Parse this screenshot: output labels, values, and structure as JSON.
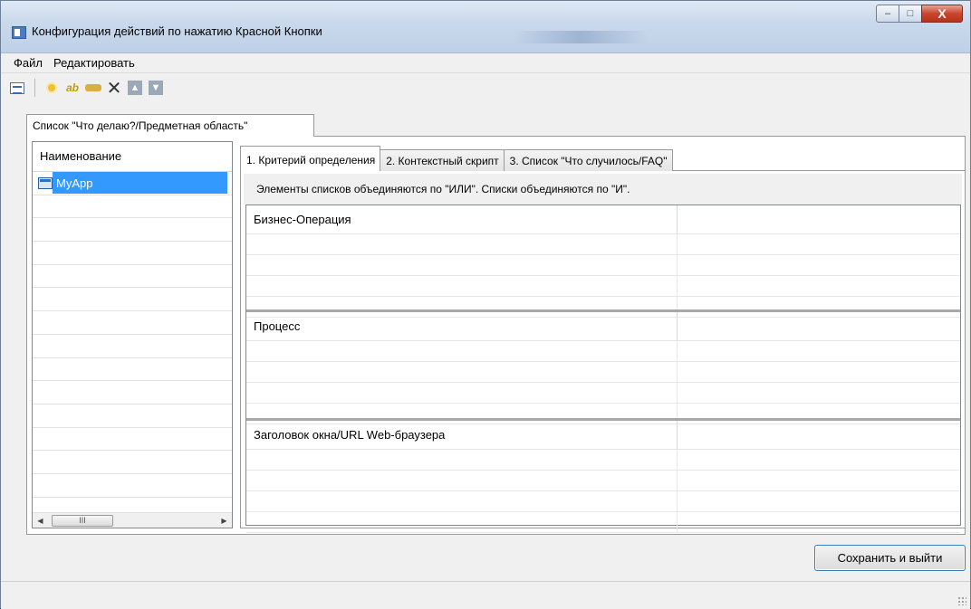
{
  "window": {
    "title": "Конфигурация действий по нажатию Красной Кнопки",
    "buttons": {
      "minimize": "–",
      "maximize": "□",
      "close": "X"
    }
  },
  "menubar": {
    "items": [
      "Файл",
      "Редактировать"
    ]
  },
  "toolbar": {
    "icons": [
      "properties-icon",
      "new-item-icon",
      "rename-icon",
      "key-icon",
      "delete-icon",
      "move-up-icon",
      "move-down-icon"
    ]
  },
  "outer_tab": {
    "label": "Список \"Что делаю?/Предметная область\""
  },
  "left_list": {
    "header": "Наименование",
    "items": [
      "MyApp"
    ],
    "scroll_thumb": "III"
  },
  "inner_tabs": [
    {
      "label": "1. Критерий определения",
      "active": true
    },
    {
      "label": "2. Контекстный скрипт",
      "active": false
    },
    {
      "label": "3. Список \"Что случилось/FAQ\"",
      "active": false
    }
  ],
  "info_text": "Элементы списков объединяются по \"ИЛИ\".  Списки объединяются по \"И\".",
  "grids": [
    {
      "header": "Бизнес-Операция"
    },
    {
      "header": "Процесс"
    },
    {
      "header": "Заголовок окна/URL Web-браузера"
    }
  ],
  "save_button": {
    "label": "Сохранить и выйти"
  },
  "colors": {
    "selection": "#3399ff",
    "titlebar": "#cad9ec",
    "close_button": "#c9452c"
  }
}
